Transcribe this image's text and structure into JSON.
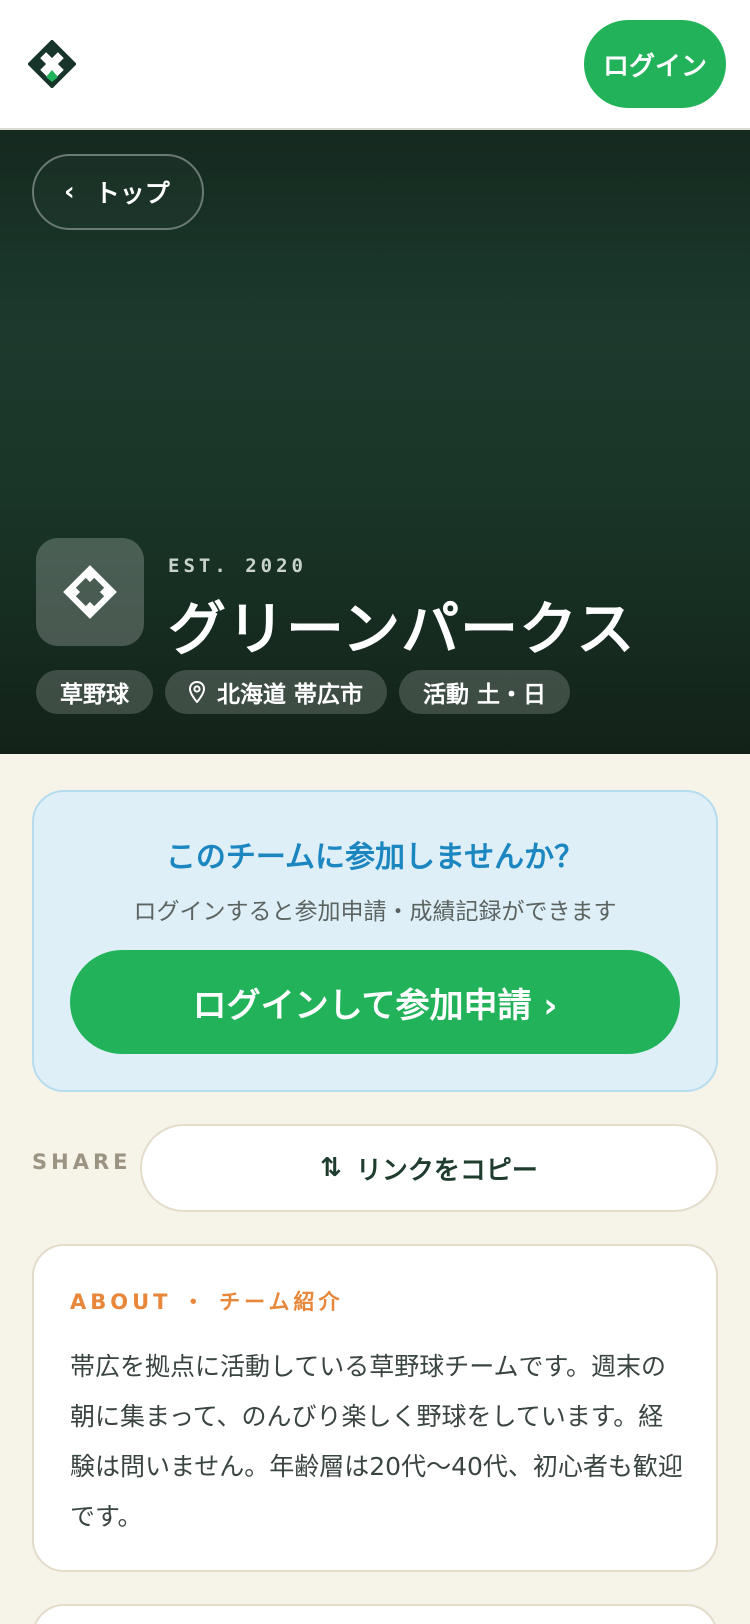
{
  "header": {
    "logo_icon": "diamond-logo-icon",
    "login_label": "ログイン"
  },
  "hero": {
    "back_label": "トップ",
    "est": "EST. 2020",
    "team_name": "グリーンパークス",
    "tags": [
      "草野球",
      "北海道 帯広市",
      "活動 土・日"
    ]
  },
  "join": {
    "title": "このチームに参加しませんか？",
    "subtitle": "ログインすると参加申請・成績記録ができます",
    "button_label": "ログインして参加申請 ›"
  },
  "share": {
    "label": "SHARE",
    "copy_label": "リンクをコピー"
  },
  "about": {
    "label": "ABOUT ・ チーム紹介",
    "text": "帯広を拠点に活動している草野球チームです。週末の朝に集まって、のんびり楽しく野球をしています。経験は問いません。年齢層は20代〜40代、初心者も歓迎です。"
  },
  "colors": {
    "accent_green": "#22b35a",
    "hero_dark": "#1b3a2d",
    "info_blue": "#1b86bf",
    "about_orange": "#e8873a"
  }
}
